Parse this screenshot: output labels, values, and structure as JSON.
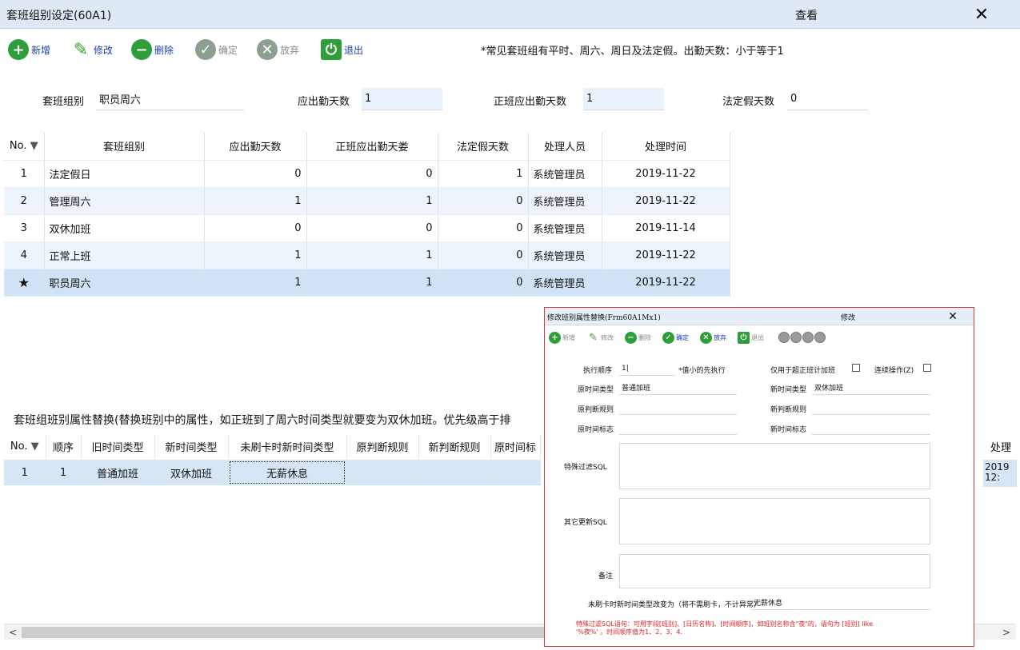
{
  "window": {
    "title": "套班组别设定(60A1)",
    "mode": "查看",
    "close_glyph": "✕"
  },
  "toolbar": [
    {
      "label": "新增",
      "icon": "plus-circle-icon",
      "color": "#2e9e3a",
      "glyph": "+"
    },
    {
      "label": "修改",
      "icon": "edit-pen-icon",
      "color": "#3a9e2e",
      "glyph": "✎"
    },
    {
      "label": "删除",
      "icon": "minus-circle-icon",
      "color": "#2e9e3a",
      "glyph": "−"
    },
    {
      "label": "确定",
      "icon": "check-circle-icon",
      "color": "#8da090",
      "glyph": "✓"
    },
    {
      "label": "放弃",
      "icon": "cancel-circle-icon",
      "color": "#8da090",
      "glyph": "✕"
    },
    {
      "label": "退出",
      "icon": "exit-icon",
      "color": "#2e9e3a",
      "glyph": "⏻"
    }
  ],
  "notice": "*常见套班组有平时、周六、周日及法定假。出勤天数：小于等于1",
  "fields": {
    "group": {
      "label": "套班组别",
      "value": "职员周六"
    },
    "attend_days": {
      "label": "应出勤天数",
      "value": "1"
    },
    "regular_days": {
      "label": "正班应出勤天数",
      "value": "1"
    },
    "holiday_days": {
      "label": "法定假天数",
      "value": "0"
    }
  },
  "grid": {
    "headers": [
      "No.",
      "套班组别",
      "应出勤天数",
      "正班应出勤天娄",
      "法定假天数",
      "处理人员",
      "处理时间"
    ],
    "rows": [
      {
        "no": "1",
        "group": "法定假日",
        "attend": "0",
        "regular": "0",
        "holiday": "1",
        "operator": "系统管理员",
        "time": "2019-11-22"
      },
      {
        "no": "2",
        "group": "管理周六",
        "attend": "1",
        "regular": "1",
        "holiday": "0",
        "operator": "系统管理员",
        "time": "2019-11-22"
      },
      {
        "no": "3",
        "group": "双休加班",
        "attend": "0",
        "regular": "0",
        "holiday": "0",
        "operator": "系统管理员",
        "time": "2019-11-14"
      },
      {
        "no": "4",
        "group": "正常上班",
        "attend": "1",
        "regular": "1",
        "holiday": "0",
        "operator": "系统管理员",
        "time": "2019-11-22"
      },
      {
        "no": "★",
        "group": "职员周六",
        "attend": "1",
        "regular": "1",
        "holiday": "0",
        "operator": "系统管理员",
        "time": "2019-11-22"
      }
    ]
  },
  "section_title": "套班组班别属性替换(替换班别中的属性，如正班到了周六时间类型就要变为双休加班。优先级高于排",
  "grid2": {
    "headers": [
      "No.",
      "顺序",
      "旧时间类型",
      "新时间类型",
      "未刷卡时新时间类型",
      "原判断规则",
      "新判断规则",
      "原时间标",
      "处理"
    ],
    "rows": [
      {
        "no": "1",
        "order": "1",
        "old_type": "普通加班",
        "new_type": "双休加班",
        "noswipe_type": "无薪休息",
        "old_rule": "",
        "new_rule": "",
        "old_mark": "",
        "time_a": "2019",
        "time_b": "12:"
      }
    ]
  },
  "scrollbar": {
    "left": "<",
    "right": ">"
  },
  "modal": {
    "title": "修改班别属性替换(Frm60A1Mx1)",
    "mode": "修改",
    "close_glyph": "✕",
    "toolbar": [
      {
        "label": "新增",
        "icon": "plus-circle-icon",
        "color": "#2e9e3a",
        "glyph": "+",
        "tone": "gray"
      },
      {
        "label": "修改",
        "icon": "edit-pen-icon",
        "color": "#3a9e2e",
        "glyph": "✎",
        "tone": "gray"
      },
      {
        "label": "删除",
        "icon": "minus-circle-icon",
        "color": "#2e9e3a",
        "glyph": "−",
        "tone": "gray"
      },
      {
        "label": "确定",
        "icon": "check-circle-icon",
        "color": "#2e9e3a",
        "glyph": "✓",
        "tone": "blue"
      },
      {
        "label": "放弃",
        "icon": "cancel-circle-icon",
        "color": "#2e9e3a",
        "glyph": "✕",
        "tone": "blue"
      },
      {
        "label": "退出",
        "icon": "exit-icon",
        "color": "#2e9e3a",
        "glyph": "⏻",
        "tone": "gray"
      }
    ],
    "fields": {
      "exec_order": {
        "label": "执行顺序",
        "value": "1|",
        "hint": "*值小的先执行"
      },
      "only_overtime": {
        "label": "仅用于超正班计加班"
      },
      "continuous": {
        "label": "连续操作(Z)"
      },
      "old_time_type": {
        "label": "原时间类型",
        "value": "普通加班"
      },
      "new_time_type": {
        "label": "新时间类型",
        "value": "双休加班"
      },
      "old_rule": {
        "label": "原判断规则",
        "value": ""
      },
      "new_rule": {
        "label": "新判断规则",
        "value": ""
      },
      "old_mark": {
        "label": "原时间标志",
        "value": ""
      },
      "new_mark": {
        "label": "新时间标志",
        "value": ""
      },
      "filter_sql": {
        "label": "特殊过滤SQL",
        "value": ""
      },
      "other_sql": {
        "label": "其它更新SQL",
        "value": ""
      },
      "remark": {
        "label": "备注",
        "value": ""
      },
      "noswipe": {
        "label": "未刷卡时新时间类型改变为（将不需刷卡，不计异常）",
        "value": "无薪休息"
      }
    },
    "note_line1": "特殊过滤SQL语句：可用字段[班别]、[日历名称]、[时间顺序]，如班别名称含\"夜\"的，语句为 [班别] like",
    "note_line2": "'%夜%' 。时间顺序值为1、2、3、4."
  }
}
